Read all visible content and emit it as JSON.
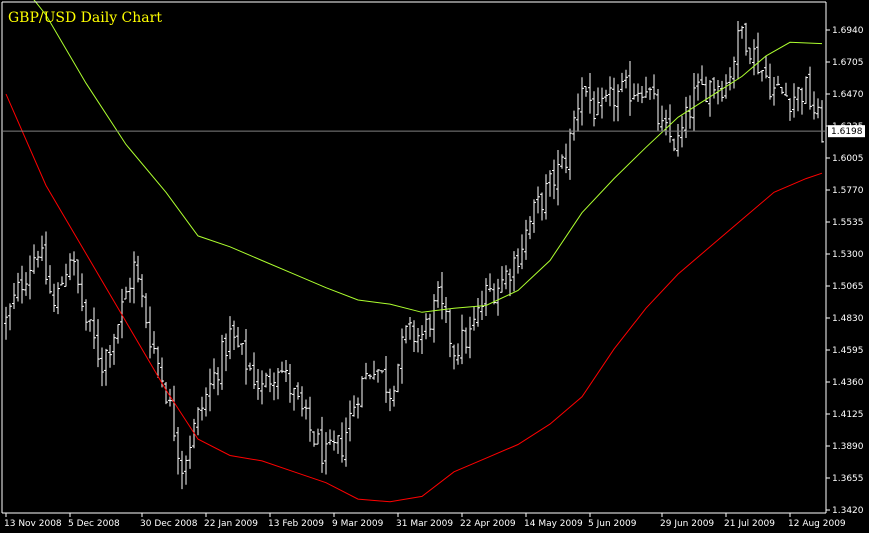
{
  "chart_data": {
    "type": "ohlc",
    "title": "GBP/USD Daily Chart",
    "current_price": "1.6198",
    "current_value": 1.6198,
    "ylim": [
      1.342,
      1.712
    ],
    "y_ticks": [
      "1.6940",
      "1.6705",
      "1.6470",
      "1.6235",
      "1.6005",
      "1.5770",
      "1.5535",
      "1.5300",
      "1.5065",
      "1.4830",
      "1.4595",
      "1.4360",
      "1.4125",
      "1.3890",
      "1.3655",
      "1.3420"
    ],
    "x_labels": [
      "13 Nov 2008",
      "5 Dec 2008",
      "30 Dec 2008",
      "22 Jan 2009",
      "13 Feb 2009",
      "9 Mar 2009",
      "31 Mar 2009",
      "22 Apr 2009",
      "14 May 2009",
      "5 Jun 2009",
      "29 Jun 2009",
      "21 Jul 2009",
      "12 Aug 2009"
    ],
    "x_label_bar_index": [
      0,
      16,
      34,
      50,
      66,
      82,
      98,
      114,
      130,
      146,
      164,
      180,
      196
    ],
    "bar_count": 205,
    "close_anchors": [
      [
        0,
        1.48
      ],
      [
        4,
        1.51
      ],
      [
        8,
        1.535
      ],
      [
        12,
        1.49
      ],
      [
        16,
        1.53
      ],
      [
        20,
        1.48
      ],
      [
        24,
        1.45
      ],
      [
        28,
        1.48
      ],
      [
        32,
        1.52
      ],
      [
        36,
        1.47
      ],
      [
        40,
        1.43
      ],
      [
        44,
        1.375
      ],
      [
        48,
        1.41
      ],
      [
        52,
        1.44
      ],
      [
        56,
        1.47
      ],
      [
        60,
        1.45
      ],
      [
        64,
        1.43
      ],
      [
        68,
        1.45
      ],
      [
        72,
        1.425
      ],
      [
        76,
        1.4
      ],
      [
        80,
        1.38
      ],
      [
        84,
        1.39
      ],
      [
        88,
        1.43
      ],
      [
        92,
        1.45
      ],
      [
        96,
        1.43
      ],
      [
        100,
        1.47
      ],
      [
        104,
        1.47
      ],
      [
        108,
        1.495
      ],
      [
        112,
        1.46
      ],
      [
        116,
        1.47
      ],
      [
        120,
        1.5
      ],
      [
        124,
        1.51
      ],
      [
        128,
        1.53
      ],
      [
        132,
        1.56
      ],
      [
        136,
        1.58
      ],
      [
        140,
        1.6
      ],
      [
        144,
        1.655
      ],
      [
        148,
        1.63
      ],
      [
        152,
        1.645
      ],
      [
        156,
        1.65
      ],
      [
        160,
        1.655
      ],
      [
        164,
        1.62
      ],
      [
        168,
        1.61
      ],
      [
        172,
        1.645
      ],
      [
        176,
        1.655
      ],
      [
        180,
        1.655
      ],
      [
        184,
        1.695
      ],
      [
        188,
        1.67
      ],
      [
        192,
        1.65
      ],
      [
        196,
        1.645
      ],
      [
        200,
        1.65
      ],
      [
        204,
        1.6198
      ]
    ],
    "series": [
      {
        "color": "#adff2f",
        "values": [
          [
            0,
            1.742
          ],
          [
            10,
            1.705
          ],
          [
            20,
            1.655
          ],
          [
            30,
            1.61
          ],
          [
            40,
            1.575
          ],
          [
            48,
            1.543
          ],
          [
            56,
            1.535
          ],
          [
            64,
            1.525
          ],
          [
            72,
            1.515
          ],
          [
            80,
            1.505
          ],
          [
            88,
            1.496
          ],
          [
            96,
            1.493
          ],
          [
            104,
            1.487
          ],
          [
            112,
            1.49
          ],
          [
            120,
            1.492
          ],
          [
            128,
            1.503
          ],
          [
            136,
            1.525
          ],
          [
            144,
            1.56
          ],
          [
            152,
            1.585
          ],
          [
            160,
            1.608
          ],
          [
            168,
            1.63
          ],
          [
            176,
            1.645
          ],
          [
            184,
            1.66
          ],
          [
            190,
            1.675
          ],
          [
            196,
            1.685
          ],
          [
            204,
            1.684
          ]
        ]
      },
      {
        "color": "#ff0000",
        "values": [
          [
            0,
            1.647
          ],
          [
            10,
            1.58
          ],
          [
            20,
            1.53
          ],
          [
            30,
            1.48
          ],
          [
            40,
            1.43
          ],
          [
            48,
            1.394
          ],
          [
            56,
            1.382
          ],
          [
            64,
            1.378
          ],
          [
            72,
            1.37
          ],
          [
            80,
            1.362
          ],
          [
            88,
            1.35
          ],
          [
            96,
            1.348
          ],
          [
            104,
            1.352
          ],
          [
            112,
            1.37
          ],
          [
            120,
            1.38
          ],
          [
            128,
            1.39
          ],
          [
            136,
            1.405
          ],
          [
            144,
            1.425
          ],
          [
            152,
            1.46
          ],
          [
            160,
            1.49
          ],
          [
            168,
            1.515
          ],
          [
            176,
            1.535
          ],
          [
            184,
            1.555
          ],
          [
            192,
            1.575
          ],
          [
            200,
            1.585
          ],
          [
            204,
            1.589
          ]
        ]
      }
    ],
    "colors": {
      "background": "#000000",
      "bars": "#ffffff",
      "title": "#ffff00",
      "axis": "#ffffff",
      "price_line": "#808080"
    }
  }
}
